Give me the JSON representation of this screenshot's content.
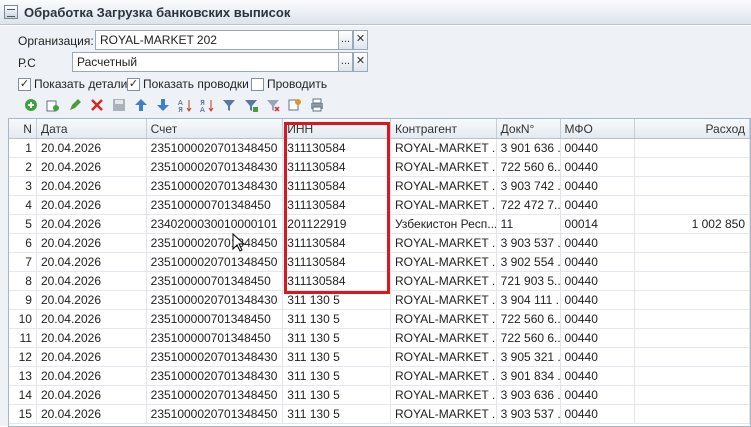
{
  "window": {
    "title": "Обработка  Загрузка банковских выписок"
  },
  "form": {
    "organization": {
      "label": "Организация:",
      "value": "ROYAL-MARKET 202"
    },
    "account": {
      "label": "Р.С",
      "value": "Расчетный"
    },
    "field_buttons": {
      "select": "...",
      "clear": "✕"
    },
    "checkboxes": [
      {
        "label": "Показать детали",
        "checked": true
      },
      {
        "label": "Показать проводки",
        "checked": true
      },
      {
        "label": "Проводить",
        "checked": false
      }
    ]
  },
  "toolbar": {
    "icons": [
      "add-icon",
      "copy-icon",
      "edit-icon",
      "delete-icon",
      "save-icon",
      "move-up-icon",
      "move-down-icon",
      "sort-asc-icon",
      "sort-desc-icon",
      "filter-icon",
      "filter-by-value-icon",
      "clear-filter-icon",
      "settings-icon",
      "print-icon"
    ]
  },
  "table": {
    "headers": [
      "N",
      "Дата",
      "Счет",
      "ИНН",
      "Контрагент",
      "ДокN°",
      "МФО",
      "Расход"
    ],
    "rows": [
      [
        "1",
        "20.04.2026",
        "23510000207013484​50",
        "311130584",
        "ROYAL-MARKET ...",
        "3 901 636 ...",
        "00440",
        ""
      ],
      [
        "2",
        "20.04.2026",
        "23510000207013484​30",
        "311130584",
        "ROYAL-MARKET ...",
        "722 560 6...",
        "00440",
        ""
      ],
      [
        "3",
        "20.04.2026",
        "23510000207013484​30",
        "311130584",
        "ROYAL-MARKET ...",
        "3 903 742 ...",
        "00440",
        ""
      ],
      [
        "4",
        "20.04.2026",
        "23510000070134845​0",
        "311130584",
        "ROYAL-MARKET ...",
        "722 472 7...",
        "00440",
        ""
      ],
      [
        "5",
        "20.04.2026",
        "23402000300100001​01",
        "201122919",
        "Узбекистон Респ...",
        "11",
        "00014",
        "1 002 850"
      ],
      [
        "6",
        "20.04.2026",
        "23510000207013484​50",
        "311130584",
        "ROYAL-MARKET ...",
        "3 903 537 ...",
        "00440",
        ""
      ],
      [
        "7",
        "20.04.2026",
        "23510000207013484​50",
        "311130584",
        "ROYAL-MARKET ...",
        "3 902 554 ...",
        "00440",
        ""
      ],
      [
        "8",
        "20.04.2026",
        "23510000070134845​0",
        "311130584",
        "ROYAL-MARKET ...",
        "721 903 5...",
        "00440",
        ""
      ],
      [
        "9",
        "20.04.2026",
        "23510000207013484​30",
        "311 130 5",
        "ROYAL-MARKET ...",
        "3 904 111 ...",
        "00440",
        ""
      ],
      [
        "10",
        "20.04.2026",
        "23510000070134845​0",
        "311 130 5",
        "ROYAL-MARKET ...",
        "722 560 6...",
        "00440",
        ""
      ],
      [
        "11",
        "20.04.2026",
        "23510000070134845​0",
        "311 130 5",
        "ROYAL-MARKET ...",
        "722 560 6...",
        "00440",
        ""
      ],
      [
        "12",
        "20.04.2026",
        "23510000207013484​30",
        "311 130 5",
        "ROYAL-MARKET ...",
        "3 905 321 ...",
        "00440",
        ""
      ],
      [
        "13",
        "20.04.2026",
        "23510000207013484​30",
        "311 130 5",
        "ROYAL-MARKET ...",
        "3 901 834 ...",
        "00440",
        ""
      ],
      [
        "14",
        "20.04.2026",
        "23510000207013484​50",
        "311 130 5",
        "ROYAL-MARKET ...",
        "3 903 636 ...",
        "00440",
        ""
      ],
      [
        "15",
        "20.04.2026",
        "23510000207013484​50",
        "311 130 5",
        "ROYAL-MARKET ...",
        "3 903 537 ...",
        "00440",
        ""
      ]
    ]
  },
  "colors": {
    "highlight": "#d8171f",
    "panel": "#eef2f6"
  }
}
